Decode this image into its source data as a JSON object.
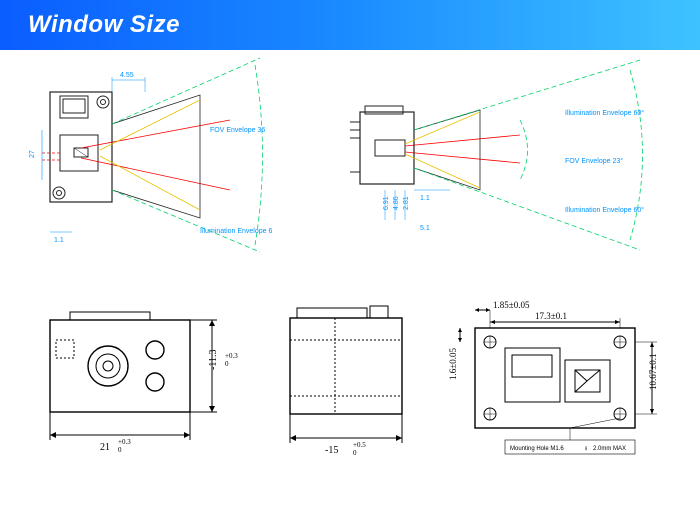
{
  "header": {
    "title": "Window Size"
  },
  "top_left": {
    "dim_top": "4.55",
    "dim_vert": "27",
    "dim_bottom": "1.1",
    "label_fov": "FOV Envelope 36",
    "label_illum": "Illumination Envelope 6"
  },
  "top_right": {
    "dim_left": "1.1",
    "dim_bottom1": "6.91",
    "dim_bottom2": "4.86",
    "dim_bottom3": "2.81",
    "dim_bottom4": "5.1",
    "label_fov": "FOV Envelope 23°",
    "label_illum_top": "Illumination Envelope 60°",
    "label_illum_bot": "Illumination Envelope 60°"
  },
  "bottom_left": {
    "width": "21",
    "width_tol_top": "+0.3",
    "width_tol_bot": "0",
    "height": "-11.3",
    "height_tol_top": "+0.3",
    "height_tol_bot": "0"
  },
  "bottom_mid": {
    "width": "-15",
    "width_tol_top": "+0.5",
    "width_tol_bot": "0"
  },
  "bottom_right": {
    "dim_top1": "1.85±0.05",
    "dim_top2": "17.3±0.1",
    "dim_left": "1.6±0.05",
    "dim_right": "10.67±0.1",
    "note": "Mounting Hole M1.6",
    "note2": "2.0mm MAX"
  }
}
